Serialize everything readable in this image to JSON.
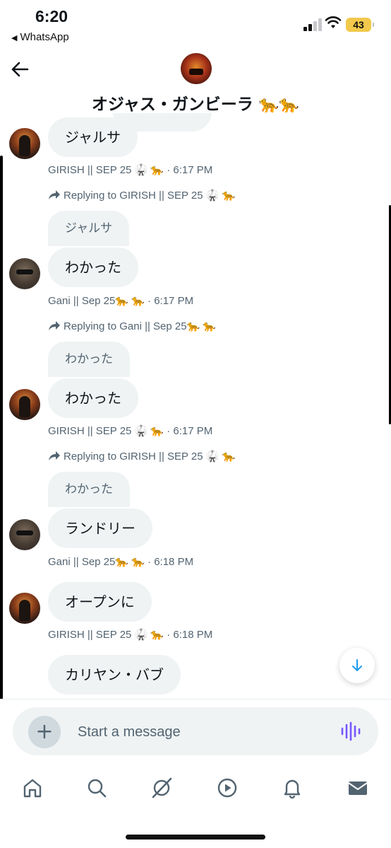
{
  "status_bar": {
    "time": "6:20",
    "back_app": "WhatsApp",
    "battery": "43",
    "icons": [
      "signal-icon",
      "wifi-icon",
      "battery-icon"
    ]
  },
  "header": {
    "title": "オジャス・ガンビーラ 🐆🐆",
    "back_icon": "back-arrow-icon",
    "avatar_icon": "group-avatar"
  },
  "messages": [
    {
      "sender": "GIRISH",
      "bubble": "ジャルサ",
      "meta": "GIRISH || SEP 25 🥋 🐆  · 6:17 PM",
      "reply_to": "Replying to GIRISH || SEP 25 🥋 🐆"
    },
    {
      "sender": "Gani",
      "quote": "ジャルサ",
      "bubble": "わかった",
      "meta": "Gani || Sep 25🐆 🐆  · 6:17 PM",
      "reply_to": "Replying to Gani || Sep 25🐆 🐆"
    },
    {
      "sender": "GIRISH",
      "quote": "わかった",
      "bubble": "わかった",
      "meta": "GIRISH || SEP 25 🥋 🐆  · 6:17 PM",
      "reply_to": "Replying to GIRISH || SEP 25 🥋 🐆"
    },
    {
      "sender": "Gani",
      "quote": "わかった",
      "bubble": "ランドリー",
      "meta": "Gani || Sep 25🐆 🐆  · 6:18 PM"
    },
    {
      "sender": "GIRISH",
      "bubble": "オープンに",
      "meta": "GIRISH || SEP 25 🥋 🐆  · 6:18 PM"
    },
    {
      "sender": "GIRISH",
      "bubble": "カリヤン・バブ"
    }
  ],
  "composer": {
    "placeholder": "Start a message",
    "add_icon": "plus-icon",
    "voice_icon": "voice-wave-icon"
  },
  "nav": {
    "items": [
      "home-icon",
      "search-icon",
      "grok-icon",
      "video-icon",
      "notifications-icon",
      "messages-icon"
    ]
  },
  "colors": {
    "bubble_bg": "#eff3f4",
    "muted_text": "#536471",
    "accent": "#1d9bf0",
    "voice_accent": "#7856ff"
  }
}
